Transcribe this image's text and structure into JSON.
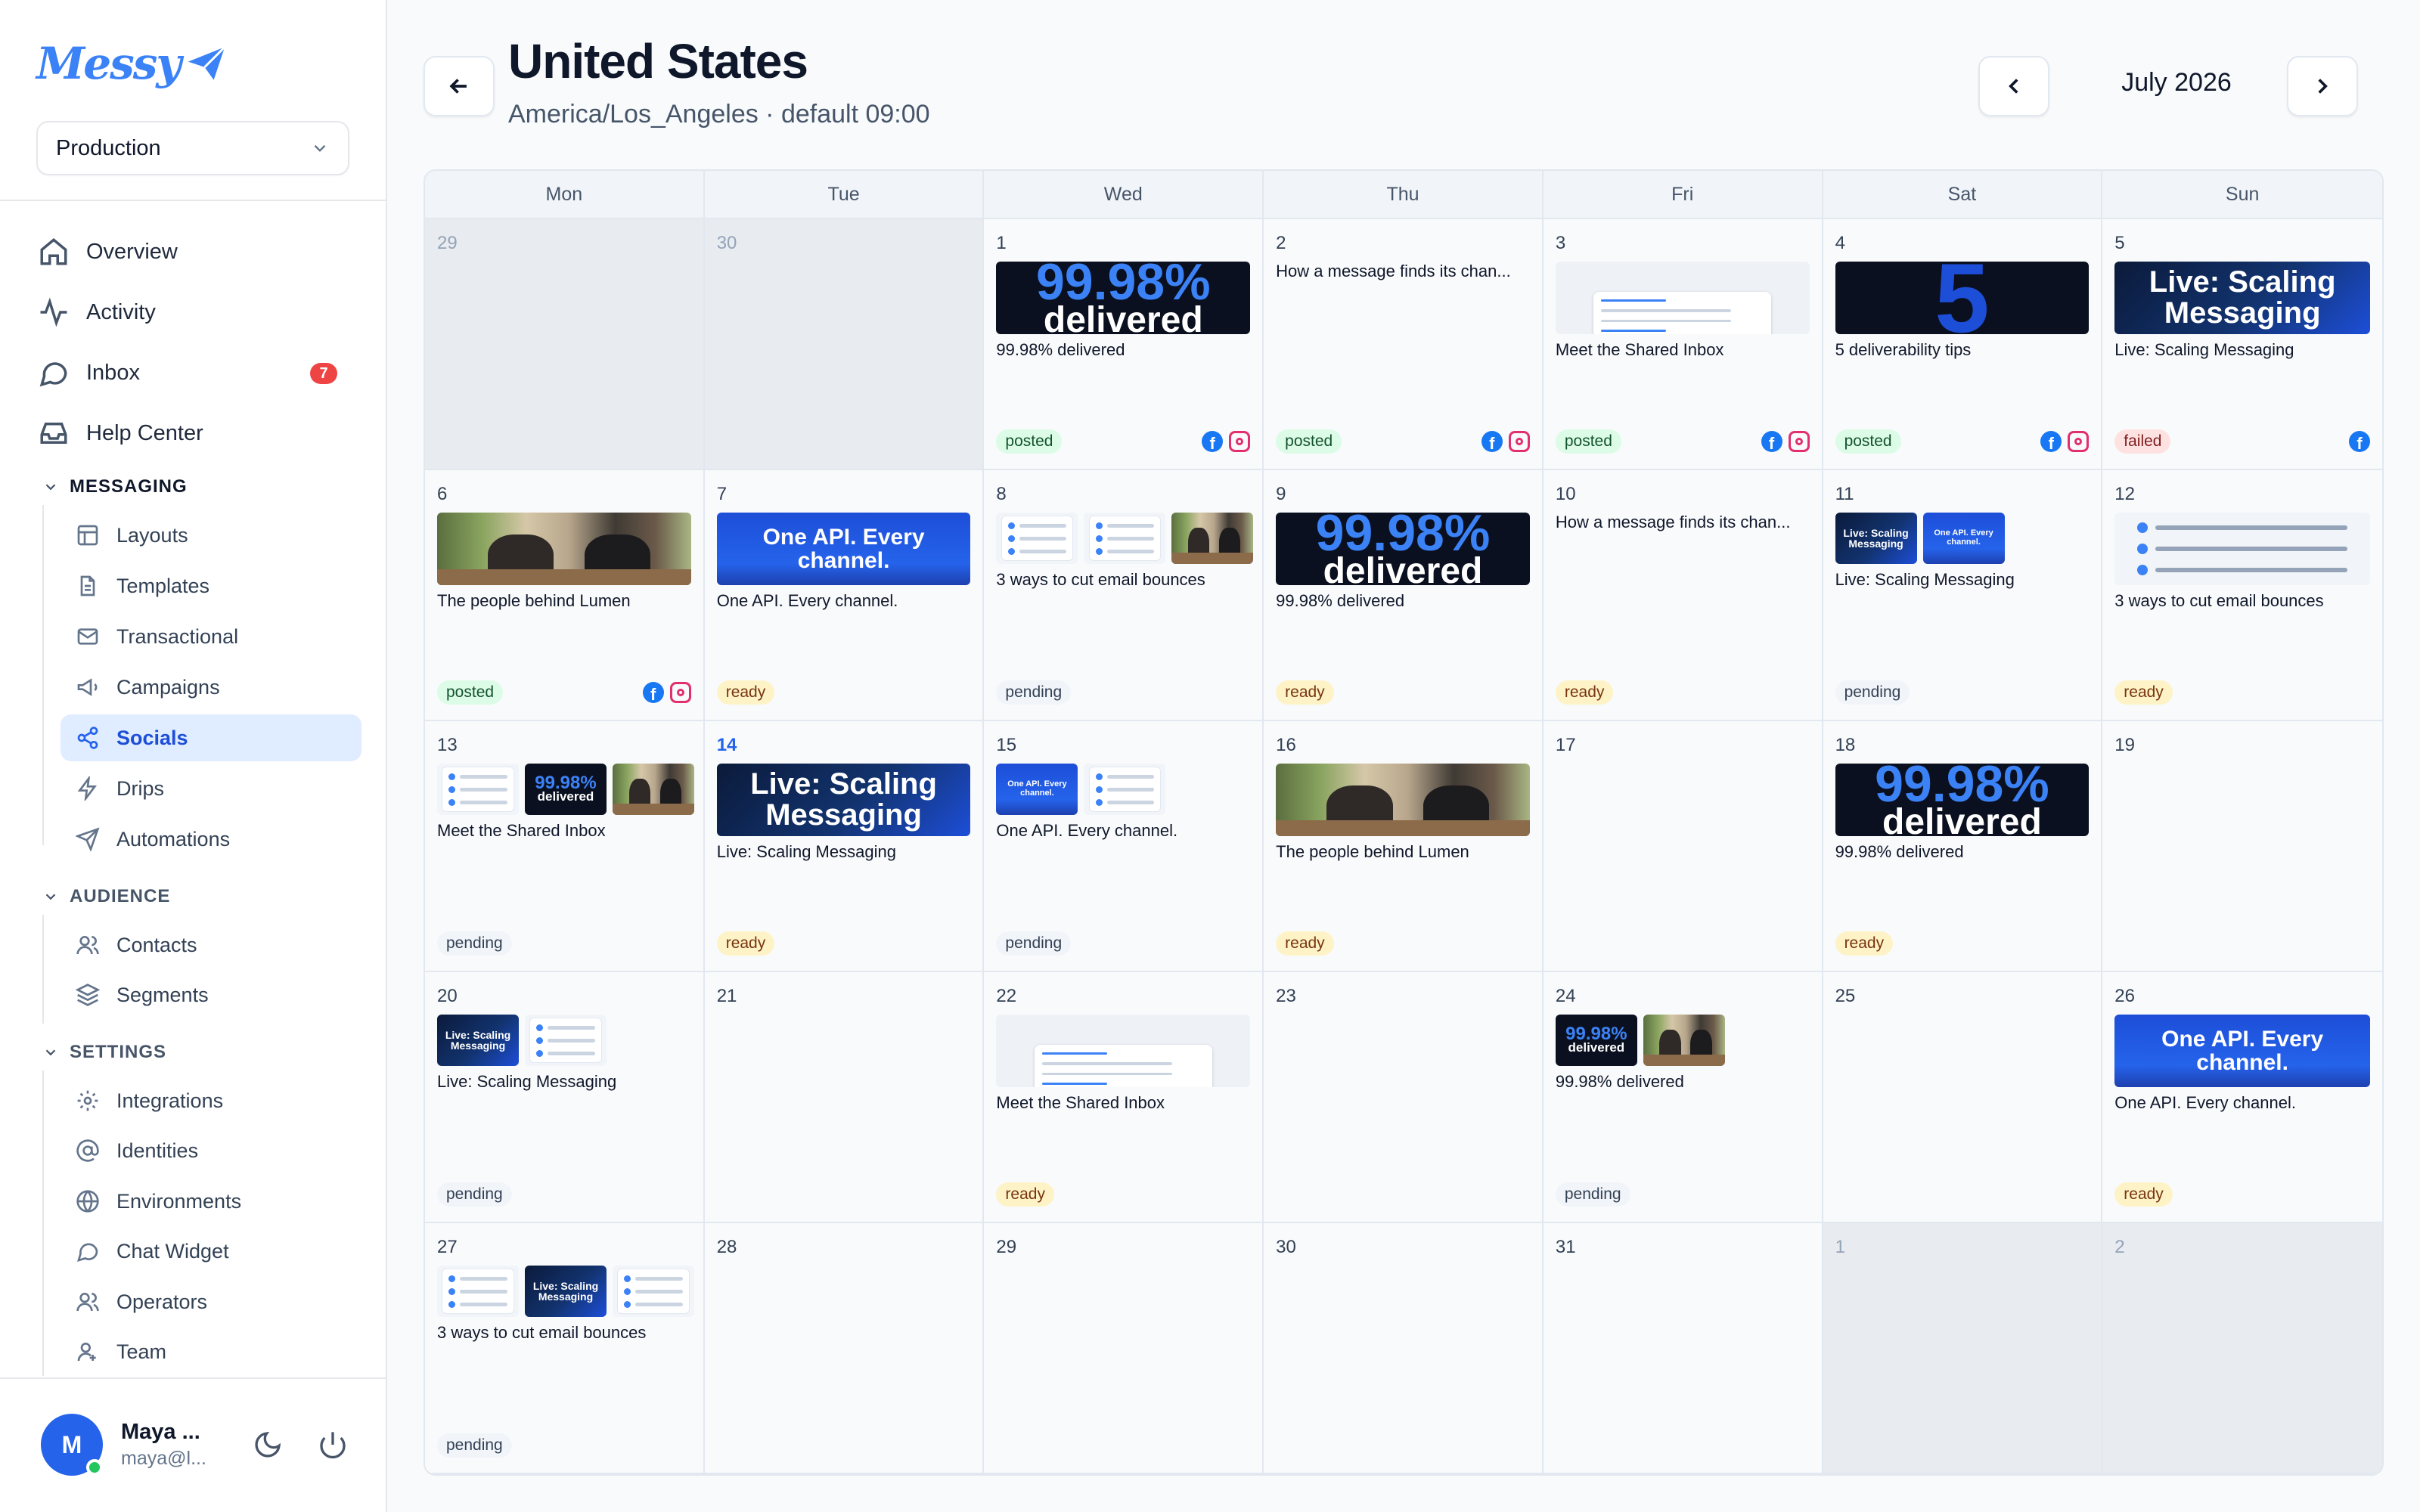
{
  "sidebar": {
    "logo": "Messy",
    "environment": "Production",
    "nav": [
      {
        "label": "Overview",
        "icon": "home-icon"
      },
      {
        "label": "Activity",
        "icon": "activity-icon"
      },
      {
        "label": "Inbox",
        "icon": "chat-icon",
        "badge": "7"
      },
      {
        "label": "Help Center",
        "icon": "inbox-tray-icon"
      }
    ],
    "sections": {
      "messaging": {
        "title": "MESSAGING",
        "items": [
          {
            "label": "Layouts",
            "icon": "layout-icon"
          },
          {
            "label": "Templates",
            "icon": "file-icon"
          },
          {
            "label": "Transactional",
            "icon": "mail-icon"
          },
          {
            "label": "Campaigns",
            "icon": "megaphone-icon"
          },
          {
            "label": "Socials",
            "icon": "share-icon",
            "active": true
          },
          {
            "label": "Drips",
            "icon": "zap-icon"
          },
          {
            "label": "Automations",
            "icon": "send-icon"
          }
        ]
      },
      "audience": {
        "title": "AUDIENCE",
        "items": [
          {
            "label": "Contacts",
            "icon": "users-icon"
          },
          {
            "label": "Segments",
            "icon": "layers-icon"
          }
        ]
      },
      "settings": {
        "title": "SETTINGS",
        "items": [
          {
            "label": "Integrations",
            "icon": "gear-icon"
          },
          {
            "label": "Identities",
            "icon": "at-icon"
          },
          {
            "label": "Environments",
            "icon": "globe-icon"
          },
          {
            "label": "Chat Widget",
            "icon": "chat-icon"
          },
          {
            "label": "Operators",
            "icon": "users-icon"
          },
          {
            "label": "Team",
            "icon": "team-icon"
          }
        ]
      }
    },
    "user": {
      "initial": "M",
      "name": "Maya ...",
      "email": "maya@l..."
    }
  },
  "header": {
    "title": "United States",
    "subtitle": "America/Los_Angeles · default 09:00",
    "month": "July 2026"
  },
  "calendar": {
    "weekdays": [
      "Mon",
      "Tue",
      "Wed",
      "Thu",
      "Fri",
      "Sat",
      "Sun"
    ],
    "days": [
      {
        "day": "29",
        "other": true,
        "thumbs": [],
        "text": "",
        "status": "",
        "socials": []
      },
      {
        "day": "30",
        "other": true,
        "thumbs": [],
        "text": "",
        "status": "",
        "socials": []
      },
      {
        "day": "1",
        "thumbs": [
          "delivered"
        ],
        "text": "99.98% delivered",
        "status": "posted",
        "socials": [
          "facebook",
          "instagram"
        ]
      },
      {
        "day": "2",
        "thumbs": [],
        "text": "How a message finds its chan...",
        "status": "posted",
        "socials": [
          "facebook",
          "instagram"
        ]
      },
      {
        "day": "3",
        "thumbs": [
          "inbox"
        ],
        "text": "Meet the Shared Inbox",
        "status": "posted",
        "socials": [
          "facebook",
          "instagram"
        ]
      },
      {
        "day": "4",
        "thumbs": [
          "five"
        ],
        "text": "5 deliverability tips",
        "status": "posted",
        "socials": [
          "facebook",
          "instagram"
        ]
      },
      {
        "day": "5",
        "thumbs": [
          "scaling"
        ],
        "text": "Live: Scaling Messaging",
        "status": "failed",
        "socials": [
          "facebook"
        ]
      },
      {
        "day": "6",
        "thumbs": [
          "photo"
        ],
        "text": "The people behind Lumen",
        "status": "posted",
        "socials": [
          "facebook",
          "instagram"
        ]
      },
      {
        "day": "7",
        "thumbs": [
          "api"
        ],
        "text": "One API. Every channel.",
        "status": "ready",
        "socials": []
      },
      {
        "day": "8",
        "small": true,
        "thumbs": [
          "list",
          "list",
          "photo"
        ],
        "text": "3 ways to cut email bounces",
        "status": "pending",
        "socials": []
      },
      {
        "day": "9",
        "thumbs": [
          "delivered"
        ],
        "text": "99.98% delivered",
        "status": "ready",
        "socials": []
      },
      {
        "day": "10",
        "thumbs": [],
        "text": "How a message finds its chan...",
        "status": "ready",
        "socials": []
      },
      {
        "day": "11",
        "small": true,
        "thumbs": [
          "scaling",
          "api"
        ],
        "text": "Live: Scaling Messaging",
        "status": "pending",
        "socials": []
      },
      {
        "day": "12",
        "thumbs": [
          "tip"
        ],
        "text": "3 ways to cut email bounces",
        "status": "ready",
        "socials": []
      },
      {
        "day": "13",
        "small": true,
        "thumbs": [
          "list",
          "delivered",
          "photo"
        ],
        "text": "Meet the Shared Inbox",
        "status": "pending",
        "socials": []
      },
      {
        "day": "14",
        "today": true,
        "thumbs": [
          "scaling"
        ],
        "text": "Live: Scaling Messaging",
        "status": "ready",
        "socials": []
      },
      {
        "day": "15",
        "small": true,
        "thumbs": [
          "api",
          "list"
        ],
        "text": "One API. Every channel.",
        "status": "pending",
        "socials": []
      },
      {
        "day": "16",
        "thumbs": [
          "photo"
        ],
        "text": "The people behind Lumen",
        "status": "ready",
        "socials": []
      },
      {
        "day": "17",
        "thumbs": [],
        "text": "",
        "status": "",
        "socials": []
      },
      {
        "day": "18",
        "thumbs": [
          "delivered"
        ],
        "text": "99.98% delivered",
        "status": "ready",
        "socials": []
      },
      {
        "day": "19",
        "thumbs": [],
        "text": "",
        "status": "",
        "socials": []
      },
      {
        "day": "20",
        "small": true,
        "thumbs": [
          "scaling",
          "list"
        ],
        "text": "Live: Scaling Messaging",
        "status": "pending",
        "socials": []
      },
      {
        "day": "21",
        "thumbs": [],
        "text": "",
        "status": "",
        "socials": []
      },
      {
        "day": "22",
        "thumbs": [
          "inbox"
        ],
        "text": "Meet the Shared Inbox",
        "status": "ready",
        "socials": []
      },
      {
        "day": "23",
        "thumbs": [],
        "text": "",
        "status": "",
        "socials": []
      },
      {
        "day": "24",
        "small": true,
        "thumbs": [
          "delivered",
          "photo"
        ],
        "text": "99.98% delivered",
        "status": "pending",
        "socials": []
      },
      {
        "day": "25",
        "thumbs": [],
        "text": "",
        "status": "",
        "socials": []
      },
      {
        "day": "26",
        "thumbs": [
          "api"
        ],
        "text": "One API. Every channel.",
        "status": "ready",
        "socials": []
      },
      {
        "day": "27",
        "small": true,
        "thumbs": [
          "list",
          "scaling",
          "list"
        ],
        "text": "3 ways to cut email bounces",
        "status": "pending",
        "socials": []
      },
      {
        "day": "28",
        "thumbs": [],
        "text": "",
        "status": "",
        "socials": []
      },
      {
        "day": "29",
        "thumbs": [],
        "text": "",
        "status": "",
        "socials": []
      },
      {
        "day": "30",
        "thumbs": [],
        "text": "",
        "status": "",
        "socials": []
      },
      {
        "day": "31",
        "thumbs": [],
        "text": "",
        "status": "",
        "socials": []
      },
      {
        "day": "1",
        "other": true,
        "thumbs": [],
        "text": "",
        "status": "",
        "socials": []
      },
      {
        "day": "2",
        "other": true,
        "thumbs": [],
        "text": "",
        "status": "",
        "socials": []
      }
    ]
  },
  "thumb_text": {
    "delivered_big": "99.98%",
    "delivered_small": "delivered",
    "scaling": "Live: Scaling Messaging",
    "api": "One API. Every channel.",
    "five": "5"
  }
}
